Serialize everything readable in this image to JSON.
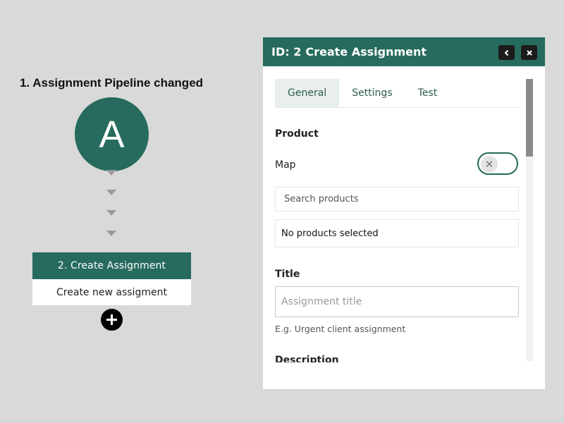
{
  "workflow": {
    "trigger_title": "1. Assignment Pipeline changed",
    "trigger_letter": "A",
    "action_header": "2. Create Assignment",
    "action_body": "Create new assigment",
    "add_icon": "plus-icon"
  },
  "panel": {
    "id_label": "ID: 2",
    "title": "Create Assignment",
    "back_icon": "chevron-left-icon",
    "close_icon": "close-icon",
    "tabs": [
      {
        "label": "General",
        "active": true
      },
      {
        "label": "Settings",
        "active": false
      },
      {
        "label": "Test",
        "active": false
      }
    ],
    "product": {
      "label": "Product",
      "map_label": "Map",
      "toggle_icon": "x-icon",
      "search_placeholder": "Search products",
      "empty_text": "No products selected"
    },
    "title_field": {
      "label": "Title",
      "placeholder": "Assignment title",
      "hint": "E.g. Urgent client assignment"
    },
    "description_label": "Description"
  },
  "colors": {
    "accent": "#266b5d",
    "background": "#d9d9d9"
  }
}
